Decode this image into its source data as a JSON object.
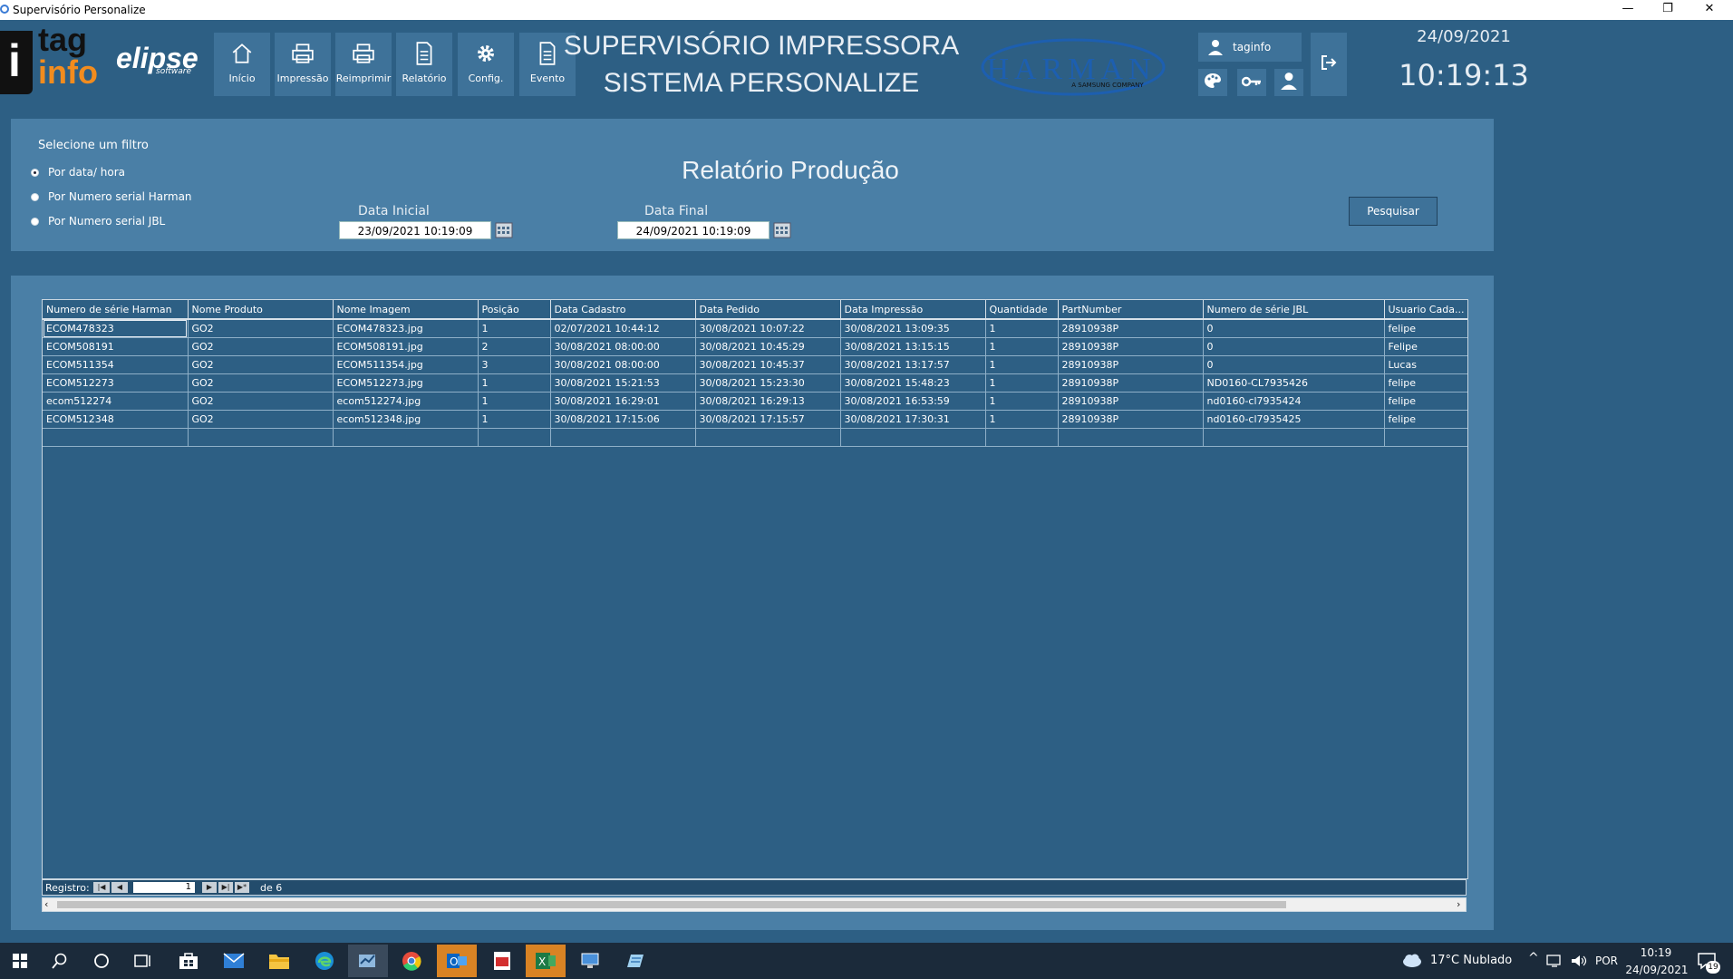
{
  "window": {
    "title": "Supervisório Personalize",
    "minimize": "—",
    "restore": "❐",
    "close": "✕"
  },
  "logos": {
    "taginfo_top": "tag",
    "taginfo_bottom": "info",
    "taginfo_i": "i",
    "elipse": "elipse",
    "elipse_sub": "software",
    "harman": "HARMAN",
    "harman_sub": "A SAMSUNG COMPANY"
  },
  "nav": [
    {
      "label": "Início",
      "icon": "home-icon"
    },
    {
      "label": "Impressão",
      "icon": "printer-icon"
    },
    {
      "label": "Reimprimir",
      "icon": "printer-icon"
    },
    {
      "label": "Relatório",
      "icon": "document-icon"
    },
    {
      "label": "Config.",
      "icon": "gear-icon"
    },
    {
      "label": "Evento",
      "icon": "document-icon"
    }
  ],
  "header": {
    "title_line1": "SUPERVISÓRIO IMPRESSORA",
    "title_line2": "SISTEMA PERSONALIZE",
    "user": "taginfo",
    "date": "24/09/2021",
    "time": "10:19:13"
  },
  "filter": {
    "title": "Selecione um filtro",
    "options": [
      "Por data/ hora",
      "Por Numero serial Harman",
      "Por Numero serial JBL"
    ],
    "selected": 0,
    "report_title": "Relatório Produção",
    "start_label": "Data Inicial",
    "start_value": "23/09/2021 10:19:09",
    "end_label": "Data Final",
    "end_value": "24/09/2021 10:19:09",
    "search_label": "Pesquisar"
  },
  "table": {
    "columns": [
      "Numero de série Harman",
      "Nome Produto",
      "Nome Imagem",
      "Posição",
      "Data Cadastro",
      "Data Pedido",
      "Data Impressão",
      "Quantidade",
      "PartNumber",
      "Numero de série JBL",
      "Usuario Cada..."
    ],
    "rows": [
      [
        "ECOM478323",
        "GO2",
        "ECOM478323.jpg",
        "1",
        "02/07/2021 10:44:12",
        "30/08/2021 10:07:22",
        "30/08/2021 13:09:35",
        "1",
        "28910938P",
        "0",
        "felipe"
      ],
      [
        "ECOM508191",
        "GO2",
        "ECOM508191.jpg",
        "2",
        "30/08/2021 08:00:00",
        "30/08/2021 10:45:29",
        "30/08/2021 13:15:15",
        "1",
        "28910938P",
        "0",
        "Felipe"
      ],
      [
        "ECOM511354",
        "GO2",
        "ECOM511354.jpg",
        "3",
        "30/08/2021 08:00:00",
        "30/08/2021 10:45:37",
        "30/08/2021 13:17:57",
        "1",
        "28910938P",
        "0",
        "Lucas"
      ],
      [
        "ECOM512273",
        "GO2",
        "ECOM512273.jpg",
        "1",
        "30/08/2021 15:21:53",
        "30/08/2021 15:23:30",
        "30/08/2021 15:48:23",
        "1",
        "28910938P",
        "ND0160-CL7935426",
        "felipe"
      ],
      [
        "ecom512274",
        "GO2",
        "ecom512274.jpg",
        "1",
        "30/08/2021 16:29:01",
        "30/08/2021 16:29:13",
        "30/08/2021 16:53:59",
        "1",
        "28910938P",
        "nd0160-cl7935424",
        "felipe"
      ],
      [
        "ECOM512348",
        "GO2",
        "ecom512348.jpg",
        "1",
        "30/08/2021 17:15:06",
        "30/08/2021 17:15:57",
        "30/08/2021 17:30:31",
        "1",
        "28910938P",
        "nd0160-cl7935425",
        "felipe"
      ]
    ],
    "record_label": "Registro:",
    "record_value": "1",
    "record_total": "de 6"
  },
  "taskbar": {
    "weather": "17°C  Nublado",
    "lang": "POR",
    "time": "10:19",
    "date": "24/09/2021",
    "notif": "19"
  }
}
